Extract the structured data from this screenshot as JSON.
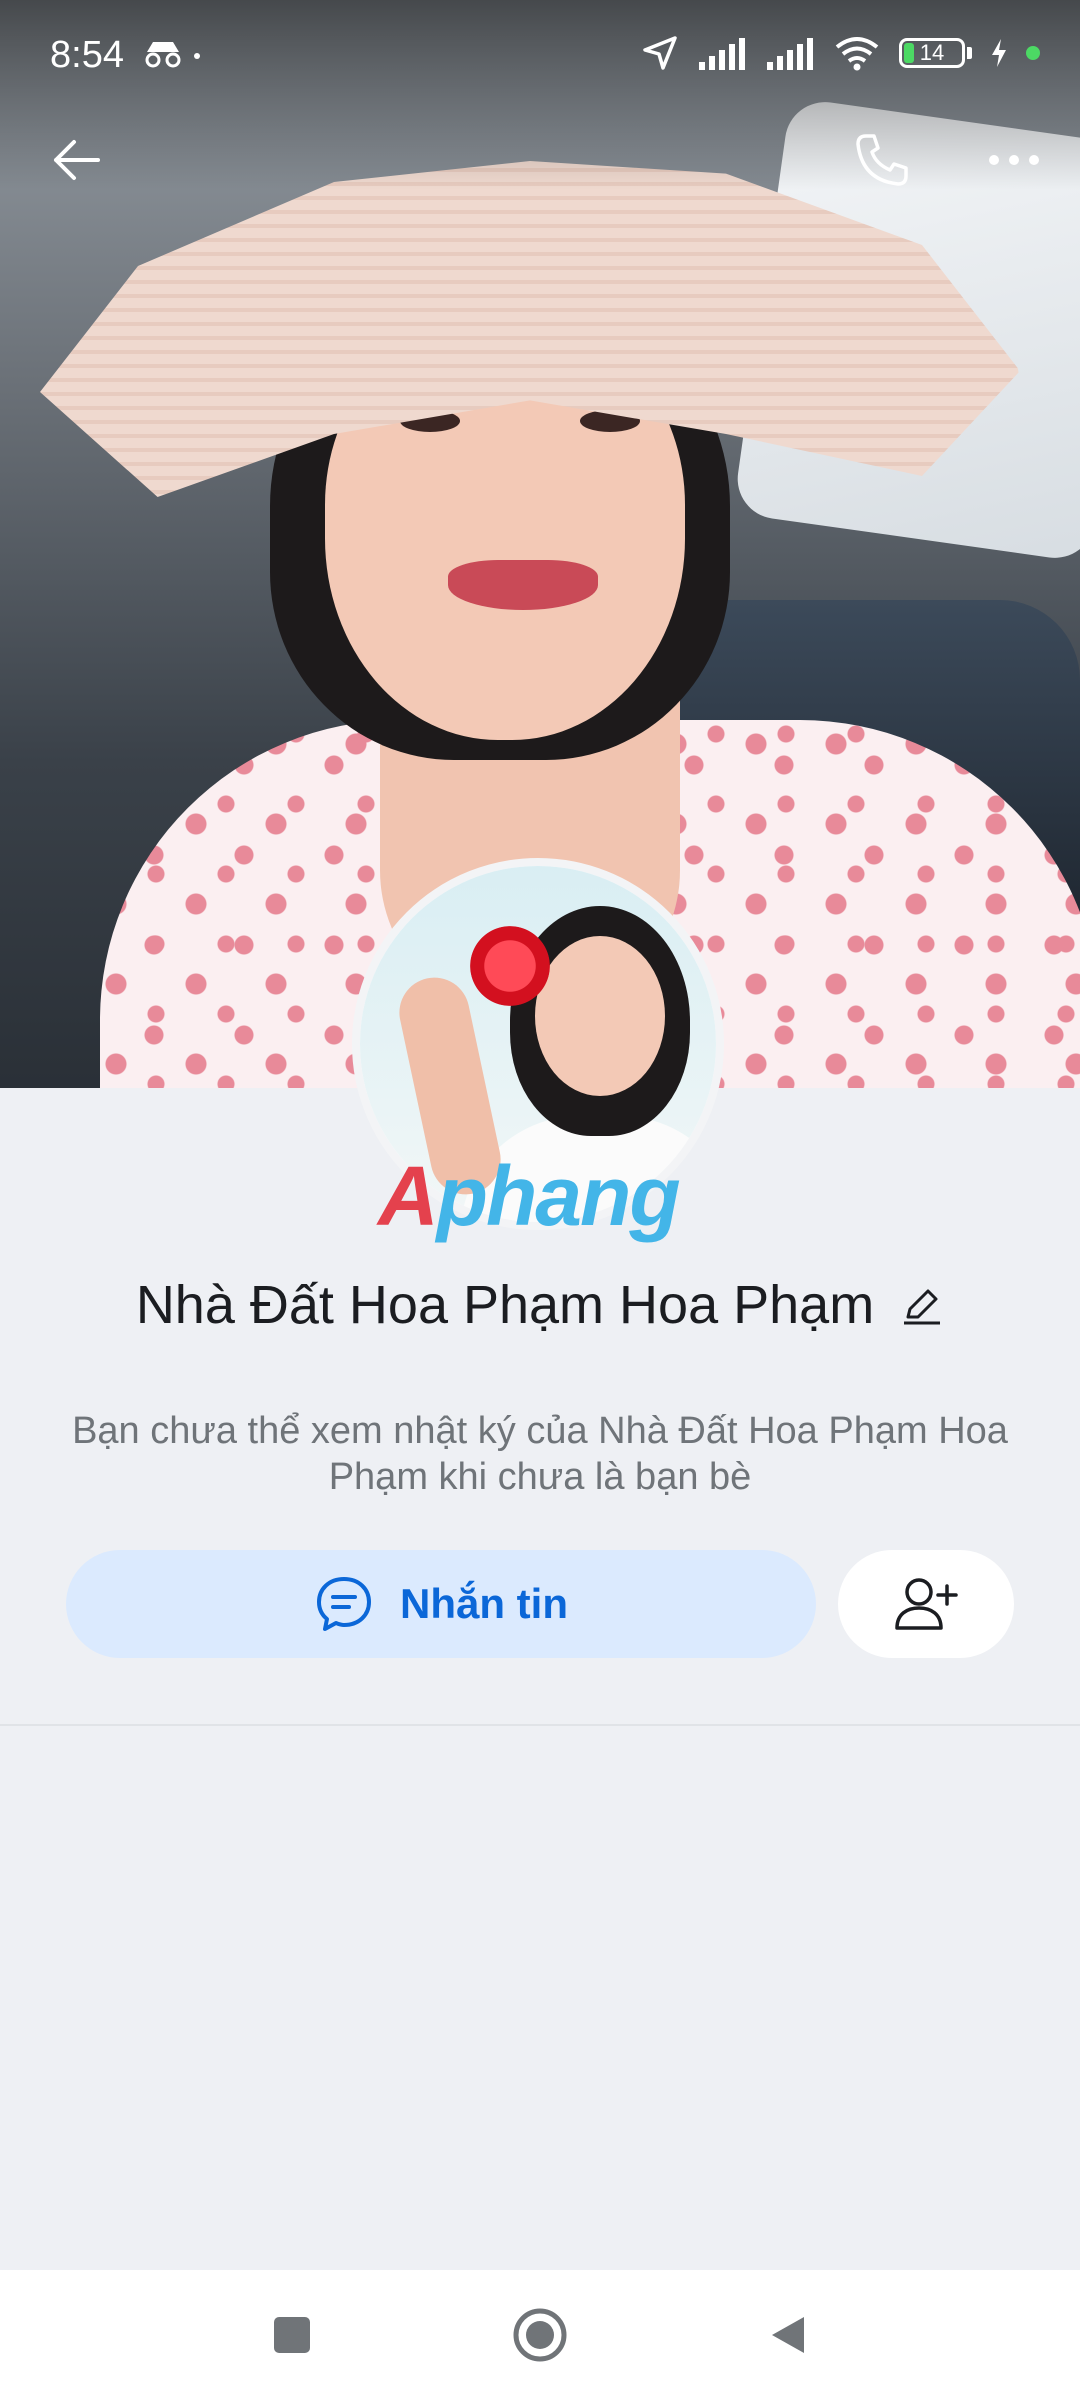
{
  "status_bar": {
    "time": "8:54",
    "battery": "14"
  },
  "profile": {
    "name": "Nhà Đất Hoa Phạm Hoa Phạm",
    "notice": "Bạn chưa thể xem nhật ký của Nhà Đất Hoa Phạm Hoa Phạm khi chưa là bạn bè"
  },
  "watermark": {
    "part1": "A",
    "part2": "phang"
  },
  "actions": {
    "message_label": "Nhắn tin"
  },
  "icons": {
    "back": "arrow-left-icon",
    "call": "phone-icon",
    "more": "more-horizontal-icon",
    "edit": "pencil-icon",
    "message": "chat-bubble-icon",
    "add_friend": "user-plus-icon",
    "nav_recent": "square-icon",
    "nav_home": "circle-icon",
    "nav_back": "triangle-back-icon"
  },
  "colors": {
    "accent": "#0b67d8",
    "message_button_bg": "#dbeafe",
    "page_bg": "#eef0f4"
  }
}
